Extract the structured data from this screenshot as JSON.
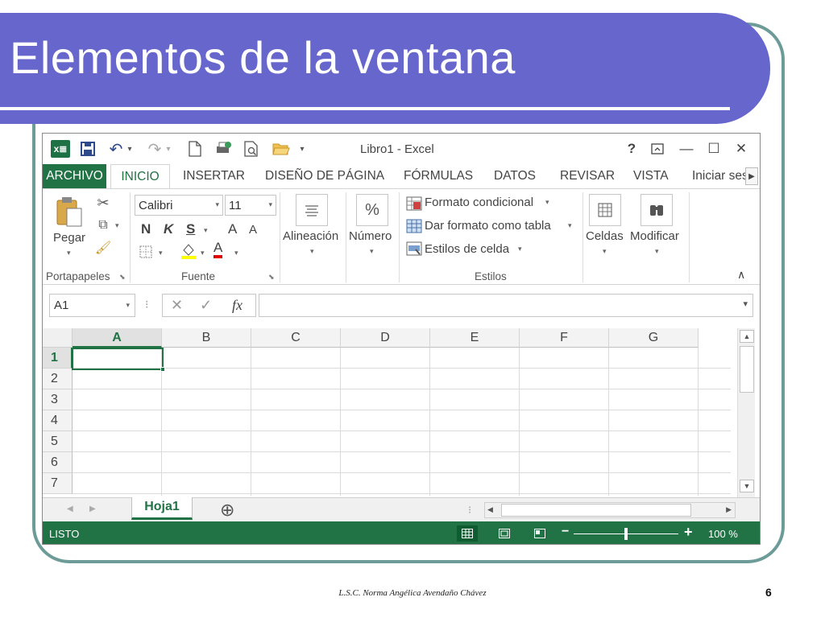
{
  "slide": {
    "title": "Elementos de la ventana",
    "footer": "L.S.C. Norma Angélica Avendaño Chávez",
    "page_number": "6"
  },
  "window": {
    "app_title": "Libro1 - Excel",
    "help": "?",
    "ribbon_display": "⊼",
    "minimize": "—",
    "maximize": "☐",
    "close": "✕"
  },
  "qat": {
    "excel_logo": "x≣",
    "save": "💾",
    "undo": "↶",
    "redo": "↷",
    "new": "🗋",
    "print_preview": "⎙",
    "open": "📂",
    "customize": "▾"
  },
  "tabs": [
    "ARCHIVO",
    "INICIO",
    "INSERTAR",
    "DISEÑO DE PÁGINA",
    "FÓRMULAS",
    "DATOS",
    "REVISAR",
    "VISTA",
    "Iniciar ses"
  ],
  "ribbon": {
    "clipboard": {
      "paste": "Pegar",
      "label": "Portapapeles"
    },
    "font": {
      "name": "Calibri",
      "size": "11",
      "bold": "N",
      "italic": "K",
      "underline": "S",
      "grow": "A",
      "shrink": "A",
      "font_color": "A",
      "label": "Fuente"
    },
    "alignment": "Alineación",
    "number": "Número",
    "number_symbol": "%",
    "styles": {
      "conditional": "Formato condicional",
      "as_table": "Dar formato como tabla",
      "cell_styles": "Estilos de celda",
      "label": "Estilos"
    },
    "cells": "Celdas",
    "modify": "Modificar",
    "collapse": "∧"
  },
  "formula_bar": {
    "name_box": "A1",
    "cancel": "✕",
    "enter": "✓",
    "fx": "fx",
    "value": ""
  },
  "grid": {
    "columns": [
      "A",
      "B",
      "C",
      "D",
      "E",
      "F",
      "G"
    ],
    "rows": [
      "1",
      "2",
      "3",
      "4",
      "5",
      "6",
      "7"
    ],
    "active_cell": "A1"
  },
  "sheets": {
    "active": "Hoja1",
    "add": "⊕"
  },
  "status": {
    "ready": "LISTO",
    "zoom_minus": "−",
    "zoom_plus": "+",
    "zoom": "100 %"
  },
  "colors": {
    "excel_green": "#217346",
    "slide_title_bg": "#6666cc",
    "frame": "#6d9c98"
  }
}
